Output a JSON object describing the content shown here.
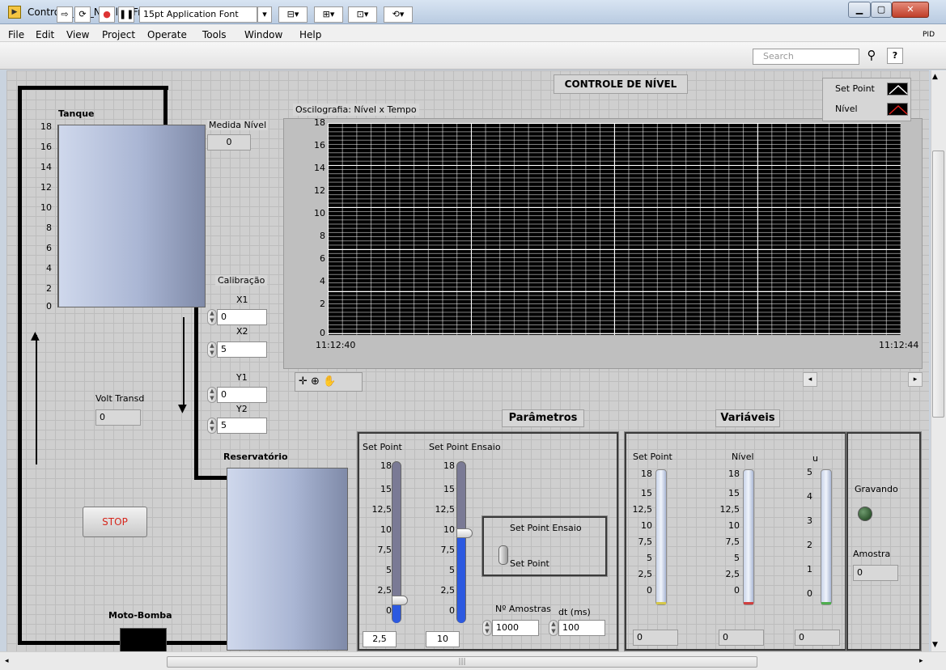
{
  "window": {
    "title": "Controle_PW_Nivel.vi Front Panel",
    "icon": "labview-vi-icon"
  },
  "menu": {
    "items": [
      "File",
      "Edit",
      "View",
      "Project",
      "Operate",
      "Tools",
      "Window",
      "Help"
    ],
    "right_label": "PID"
  },
  "toolbar": {
    "font_select": "15pt Application Font",
    "search_placeholder": "Search"
  },
  "panel": {
    "title": "CONTROLE DE NÍVEL",
    "tanque": {
      "label": "Tanque",
      "scale": [
        "18",
        "16",
        "14",
        "12",
        "10",
        "8",
        "6",
        "4",
        "2",
        "0"
      ]
    },
    "medida_nivel": {
      "label": "Medida Nível",
      "value": "0"
    },
    "calibracao": {
      "label": "Calibração",
      "x1_label": "X1",
      "x1": "0",
      "x2_label": "X2",
      "x2": "5",
      "y1_label": "Y1",
      "y1": "0",
      "y2_label": "Y2",
      "y2": "5"
    },
    "volt_transd": {
      "label": "Volt Transd",
      "value": "0"
    },
    "reservatorio_label": "Reservatório",
    "stop_label": "STOP",
    "moto_bomba_label": "Moto-Bomba",
    "graph": {
      "label": "Oscilografia: Nível x Tempo",
      "y_ticks": [
        "18",
        "16",
        "14",
        "12",
        "10",
        "8",
        "6",
        "4",
        "2",
        "0"
      ],
      "x_start": "11:12:40",
      "x_end": "11:12:44",
      "legend": [
        {
          "name": "Set Point",
          "color": "#ffffff"
        },
        {
          "name": "Nível",
          "color": "#e0201c"
        }
      ]
    },
    "parametros": {
      "title": "Parâmetros",
      "set_point_label": "Set Point",
      "set_point_ensaio_label": "Set Point Ensaio",
      "scale": [
        "18",
        "15",
        "12,5",
        "10",
        "7,5",
        "5",
        "2,5",
        "0"
      ],
      "set_point_value": "2,5",
      "set_point_ensaio_value": "10",
      "set_point_fraction": 0.139,
      "set_point_ensaio_fraction": 0.556,
      "switch_top_label": "Set Point Ensaio",
      "switch_bottom_label": "Set Point",
      "amostras_label": "Nº Amostras",
      "amostras": "1000",
      "dt_label": "dt (ms)",
      "dt": "100"
    },
    "variaveis": {
      "title": "Variáveis",
      "set_point_label": "Set Point",
      "nivel_label": "Nível",
      "u_label": "u",
      "scale": [
        "18",
        "15",
        "12,5",
        "10",
        "7,5",
        "5",
        "2,5",
        "0"
      ],
      "u_scale": [
        "5",
        "4",
        "3",
        "2",
        "1",
        "0"
      ],
      "set_point_value": "0",
      "nivel_value": "0",
      "u_value": "0"
    },
    "gravando_label": "Gravando",
    "amostra": {
      "label": "Amostra",
      "value": "0"
    }
  }
}
